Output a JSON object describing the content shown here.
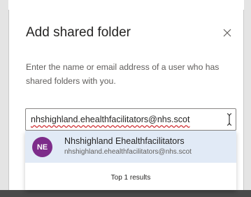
{
  "dialog": {
    "title": "Add shared folder",
    "description": "Enter the name or email address of a user who has shared folders with you.",
    "close_icon": "close-icon"
  },
  "search": {
    "value": "nhshighland.ehealthfacilitators@nhs.scot",
    "cursor_icon": "text-cursor-icon"
  },
  "suggestions": {
    "items": [
      {
        "initials": "NE",
        "name": "Nhshighland Ehealthfacilitators",
        "email": "nhshighland.ehealthfacilitators@nhs.scot",
        "avatar_color": "#7d2c8a"
      }
    ],
    "footer": "Top 1 results"
  },
  "colors": {
    "highlight": "#e1eaf6",
    "spellcheck_underline": "#d13438"
  }
}
